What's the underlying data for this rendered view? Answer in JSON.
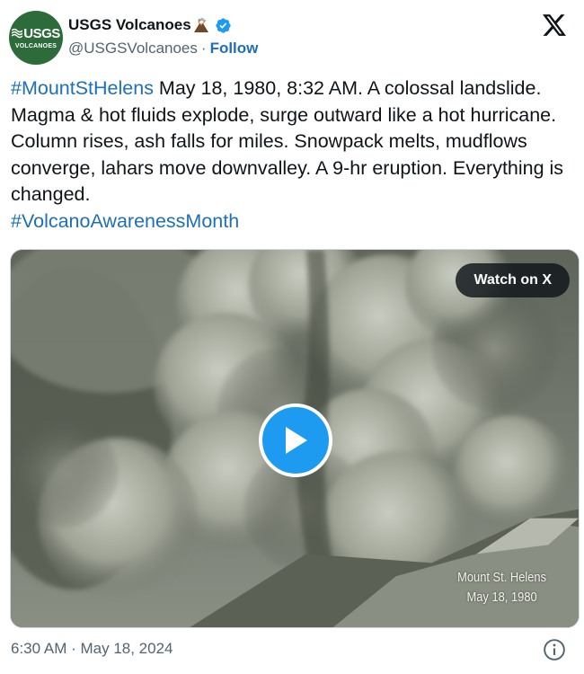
{
  "author": {
    "display_name": "USGS Volcanoes",
    "handle": "@USGSVolcanoes",
    "separator": "·",
    "follow_label": "Follow",
    "avatar_text_main": "USGS",
    "avatar_text_sub": "VOLCANOES",
    "avatar_color": "#2e6b3a",
    "verified_icon": "verified-badge-icon",
    "name_emoji": "volcano-icon"
  },
  "platform_icon": "x-logo-icon",
  "tweet": {
    "hashtag_1": "#MountStHelens",
    "body": " May 18, 1980, 8:32 AM. A colossal landslide. Magma & hot fluids explode, surge outward like a hot hurricane. Column rises, ash falls for miles. Snowpack melts, mudflows converge, lahars move downvalley. A 9-hr eruption. Everything is changed.",
    "hashtag_2": "#VolcanoAwarenessMonth"
  },
  "media": {
    "watch_label": "Watch on X",
    "play_icon": "play-icon",
    "caption_line_1": "Mount St. Helens",
    "caption_line_2": "May 18, 1980"
  },
  "footer": {
    "timestamp": "6:30 AM · May 18, 2024",
    "info_icon": "info-icon"
  },
  "colors": {
    "link": "#1d6fb8",
    "play_button": "#1d9bf0",
    "verified": "#1d9bf0",
    "muted_text": "#536471"
  }
}
